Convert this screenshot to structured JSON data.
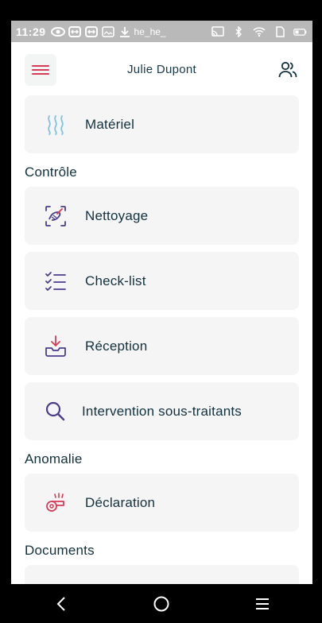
{
  "status_bar": {
    "time": "11:29",
    "extra_text": "he_he_"
  },
  "header": {
    "user_name": "Julie Dupont"
  },
  "items_top": [
    {
      "label": "Matériel",
      "icon": "heat-waves-icon"
    }
  ],
  "sections": [
    {
      "title": "Contrôle",
      "items": [
        {
          "label": "Nettoyage",
          "icon": "cleaning-icon"
        },
        {
          "label": "Check-list",
          "icon": "checklist-icon"
        },
        {
          "label": "Réception",
          "icon": "inbox-download-icon"
        },
        {
          "label": "Intervention sous-traitants",
          "icon": "search-icon"
        }
      ]
    },
    {
      "title": "Anomalie",
      "items": [
        {
          "label": "Déclaration",
          "icon": "whistle-icon"
        }
      ]
    },
    {
      "title": "Documents",
      "items": []
    }
  ],
  "colors": {
    "accent_red": "#d63b57",
    "icon_purple": "#4d3b8c",
    "icon_blue": "#7fc3dc",
    "card_bg": "#f5f5f5",
    "text_dark": "#12313f"
  }
}
